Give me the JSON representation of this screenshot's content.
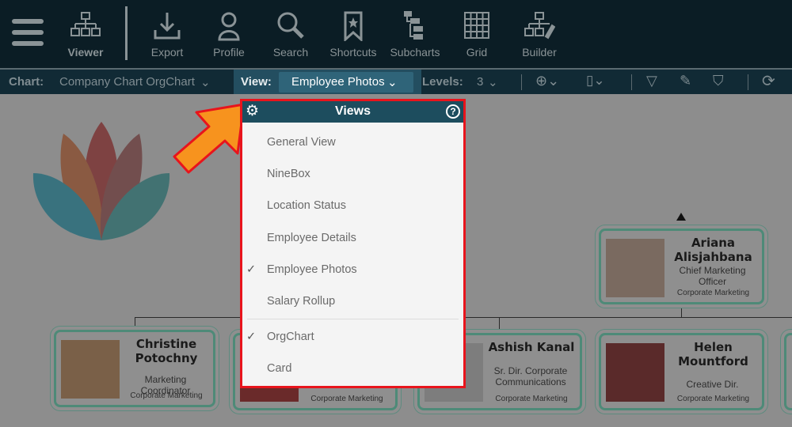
{
  "toolbar": {
    "items": [
      {
        "label": "Viewer",
        "icon": "org-chart-icon"
      },
      {
        "label": "Export",
        "icon": "download-icon"
      },
      {
        "label": "Profile",
        "icon": "person-icon"
      },
      {
        "label": "Search",
        "icon": "search-icon"
      },
      {
        "label": "Shortcuts",
        "icon": "bookmark-star-icon"
      },
      {
        "label": "Subcharts",
        "icon": "subcharts-icon"
      },
      {
        "label": "Grid",
        "icon": "grid-icon"
      },
      {
        "label": "Builder",
        "icon": "builder-icon"
      }
    ]
  },
  "subbar": {
    "chart_label": "Chart:",
    "chart_value": "Company Chart OrgChart",
    "view_label": "View:",
    "view_value": "Employee Photos",
    "levels_label": "Levels:",
    "levels_value": "3"
  },
  "menu": {
    "title": "Views",
    "items": [
      {
        "label": "General View",
        "checked": false
      },
      {
        "label": "NineBox",
        "checked": false
      },
      {
        "label": "Location Status",
        "checked": false
      },
      {
        "label": "Employee Details",
        "checked": false
      },
      {
        "label": "Employee Photos",
        "checked": true
      },
      {
        "label": "Salary Rollup",
        "checked": false
      }
    ],
    "layouts": [
      {
        "label": "OrgChart",
        "checked": true
      },
      {
        "label": "Card",
        "checked": false
      }
    ],
    "check": "✓"
  },
  "cards": [
    {
      "name": "Ariana Alisjahbana",
      "title": "Chief Marketing Officer",
      "dept": "Corporate Marketing"
    },
    {
      "name": "Christine Potochny",
      "title": "Marketing Coordinator",
      "dept": "Corporate Marketing"
    },
    {
      "name": "",
      "title": "",
      "dept": "Corporate Marketing"
    },
    {
      "name": "Ashish Kanal",
      "title": "Sr. Dir. Corporate Communications",
      "dept": "Corporate Marketing"
    },
    {
      "name": "Helen Mountford",
      "title": "Creative Dir.",
      "dept": "Corporate Marketing"
    }
  ],
  "colors": {
    "accent": "#1d4d5e",
    "highlight": "#e8141c",
    "arrow": "#f7931e"
  }
}
